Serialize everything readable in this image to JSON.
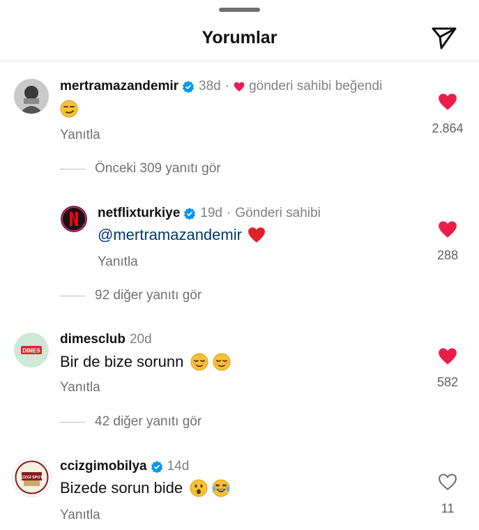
{
  "header": {
    "title": "Yorumlar"
  },
  "comments": [
    {
      "username": "mertramazandemir",
      "age": "38d",
      "separator": "·",
      "note": "gönderi sahibi beğendi",
      "text": "",
      "emojis": [
        "smirk-emoji"
      ],
      "reply_label": "Yanıtla",
      "likes": "2.864",
      "liked": true
    },
    {
      "username": "netflixturkiye",
      "age": "19d",
      "separator": "·",
      "note": "Gönderi sahibi",
      "mention": "@mertramazandemir",
      "emojis": [
        "red-heart-emoji"
      ],
      "reply_label": "Yanıtla",
      "likes": "288",
      "liked": true
    },
    {
      "username": "dimesclub",
      "age": "20d",
      "text": "Bir de bize sorunn",
      "emojis": [
        "relieved-emoji",
        "relieved-emoji"
      ],
      "reply_label": "Yanıtla",
      "likes": "582",
      "liked": true,
      "avatar_text": "DIMES"
    },
    {
      "username": "ccizgimobilya",
      "age": "14d",
      "text": "Bizede sorun bide",
      "emojis": [
        "surprised-emoji",
        "laughing-tears-emoji"
      ],
      "reply_label": "Yanıtla",
      "likes": "11",
      "liked": false,
      "avatar_text": "ÇİZGİ SPOT"
    }
  ],
  "view_more": [
    {
      "label": "Önceki 309 yanıtı gör"
    },
    {
      "label": "92 diğer yanıtı gör"
    },
    {
      "label": "42 diğer yanıtı gör"
    }
  ],
  "colors": {
    "like_red": "#ed1d49",
    "verified_blue": "#0095f6",
    "mention_blue": "#00376b"
  }
}
